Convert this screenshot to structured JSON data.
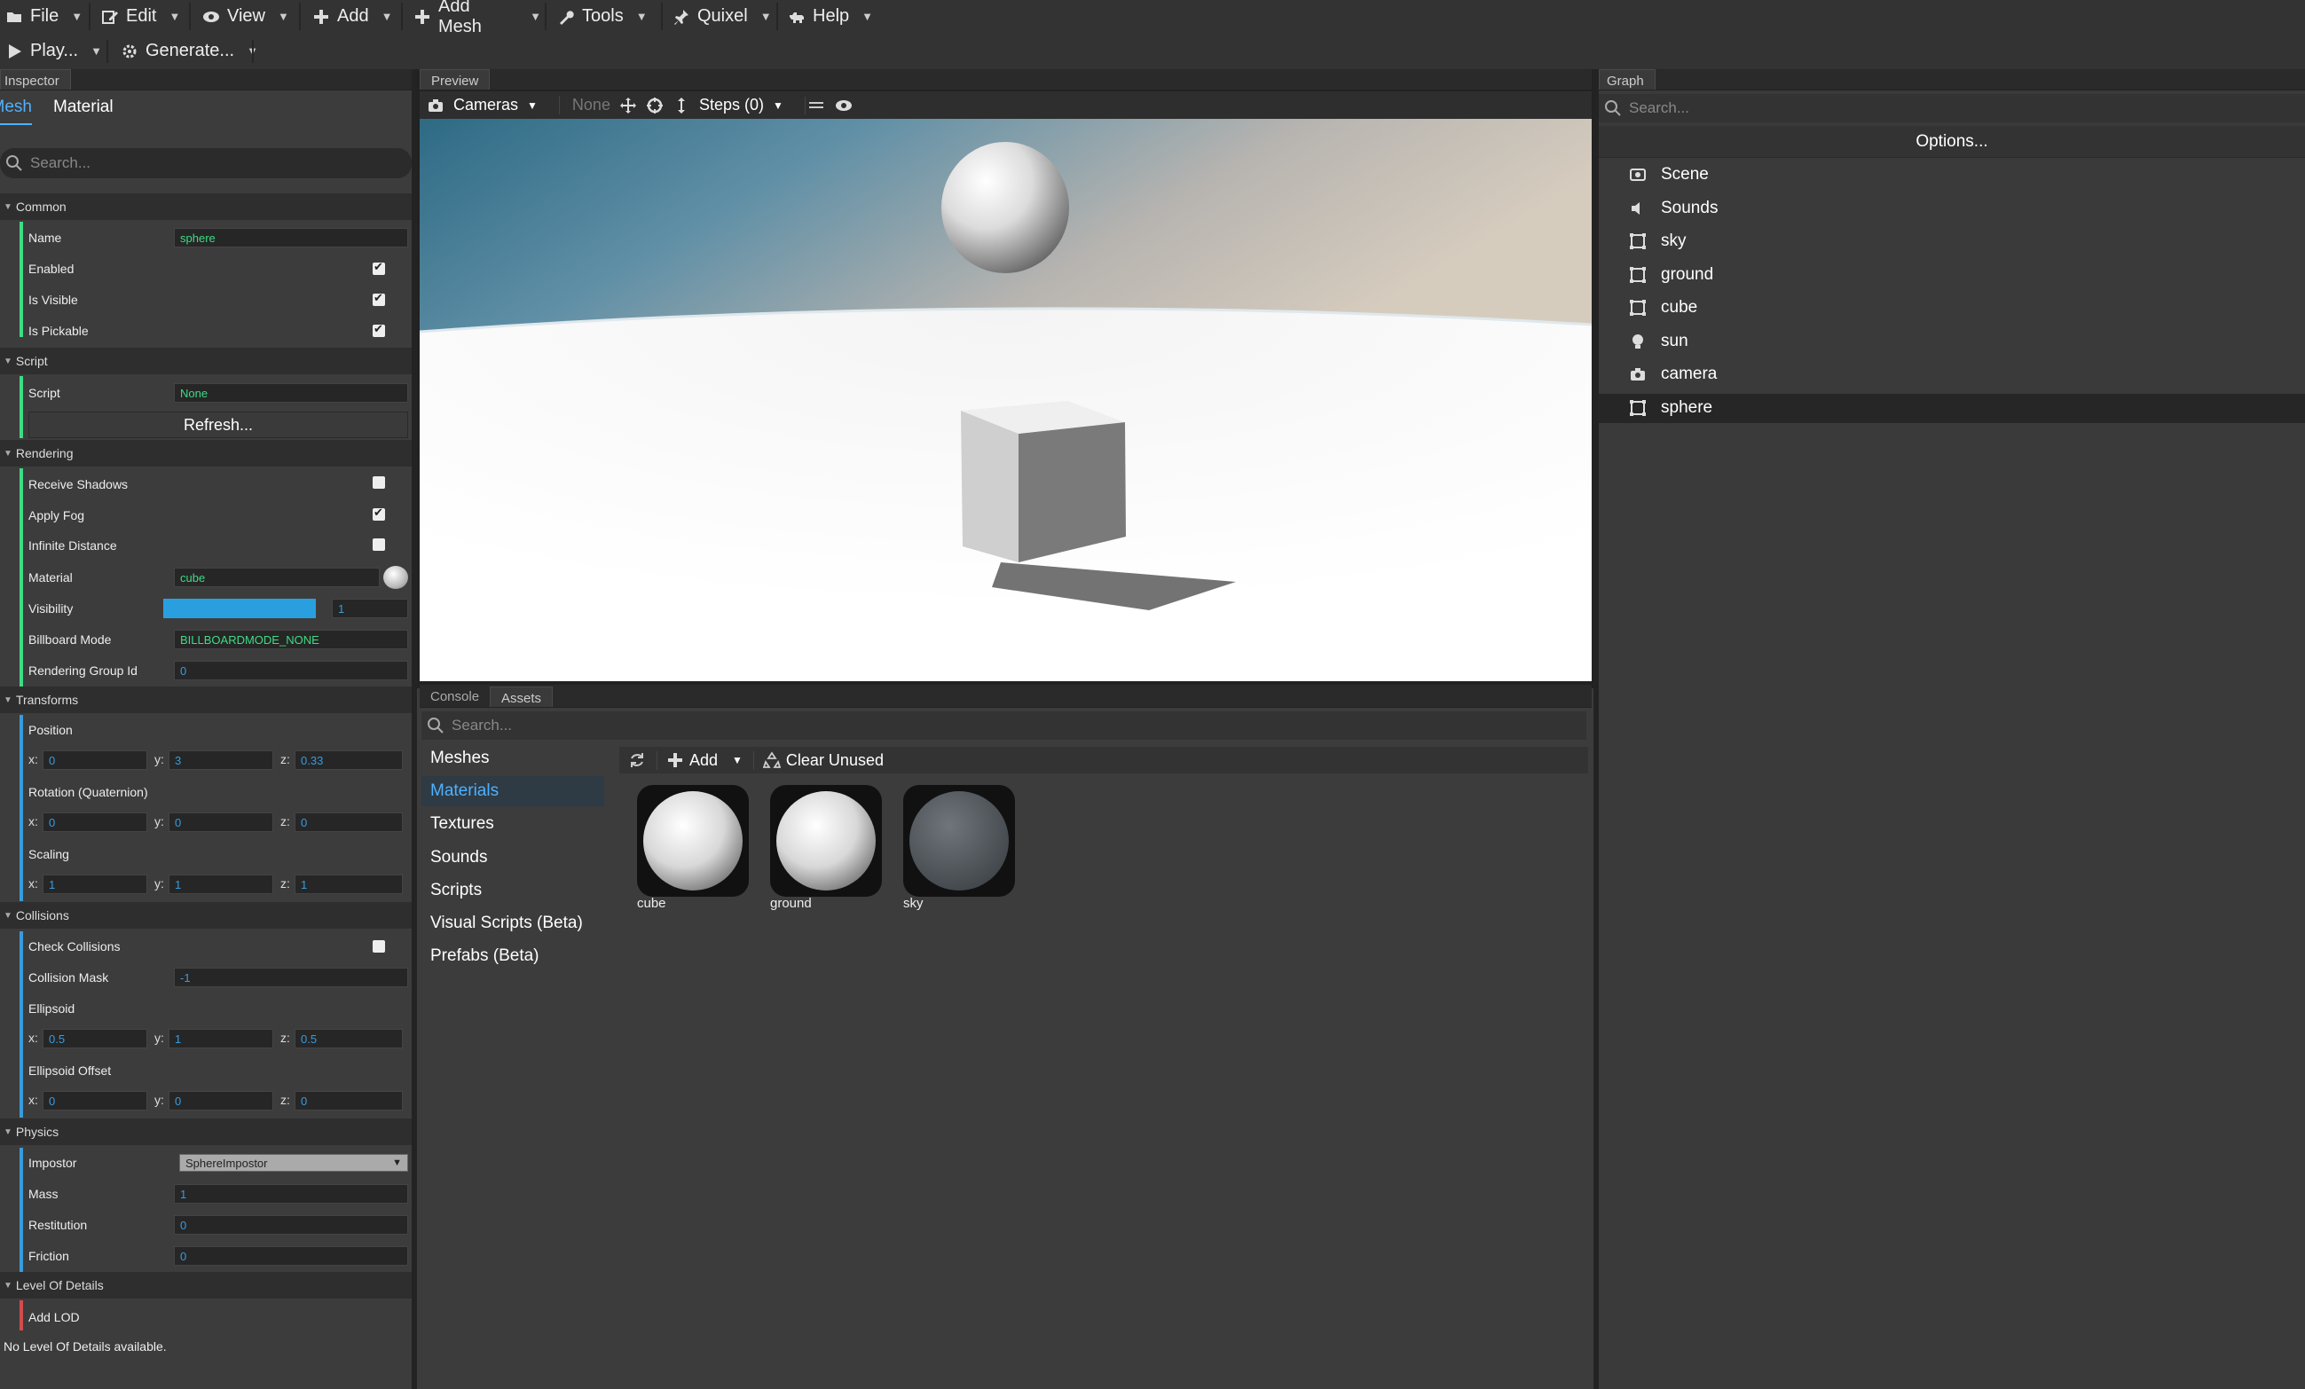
{
  "menubar": {
    "items": [
      {
        "label": "File",
        "icon": "folder-icon"
      },
      {
        "label": "Edit",
        "icon": "edit-icon"
      },
      {
        "label": "View",
        "icon": "eye-icon"
      },
      {
        "label": "Add",
        "icon": "plus-icon"
      },
      {
        "label": "Add Mesh",
        "icon": "plus-icon"
      },
      {
        "label": "Tools",
        "icon": "wrench-icon"
      },
      {
        "label": "Quixel",
        "icon": "pin-icon"
      },
      {
        "label": "Help",
        "icon": "dog-icon"
      }
    ]
  },
  "toolbar2": {
    "play_label": "Play...",
    "generate_label": "Generate..."
  },
  "inspector": {
    "title": "Inspector",
    "tab_mesh": "Mesh",
    "tab_material": "Material",
    "search_placeholder": "Search...",
    "common": {
      "title": "Common",
      "name_label": "Name",
      "name_value": "sphere",
      "enabled_label": "Enabled",
      "visible_label": "Is Visible",
      "pickable_label": "Is Pickable"
    },
    "script": {
      "title": "Script",
      "script_label": "Script",
      "script_value": "None",
      "refresh_label": "Refresh..."
    },
    "rendering": {
      "title": "Rendering",
      "receive_shadows": "Receive Shadows",
      "apply_fog": "Apply Fog",
      "infinite_distance": "Infinite Distance",
      "material_label": "Material",
      "material_value": "cube",
      "visibility_label": "Visibility",
      "visibility_value": "1",
      "billboard_label": "Billboard Mode",
      "billboard_value": "BILLBOARDMODE_NONE",
      "rgroup_label": "Rendering Group Id",
      "rgroup_value": "0"
    },
    "transforms": {
      "title": "Transforms",
      "position_label": "Position",
      "position": {
        "x": "0",
        "y": "3",
        "z": "0.33"
      },
      "rotation_label": "Rotation (Quaternion)",
      "rotation": {
        "x": "0",
        "y": "0",
        "z": "0"
      },
      "scaling_label": "Scaling",
      "scaling": {
        "x": "1",
        "y": "1",
        "z": "1"
      }
    },
    "collisions": {
      "title": "Collisions",
      "check_label": "Check Collisions",
      "mask_label": "Collision Mask",
      "mask_value": "-1",
      "ellipsoid_label": "Ellipsoid",
      "ellipsoid": {
        "x": "0.5",
        "y": "1",
        "z": "0.5"
      },
      "offset_label": "Ellipsoid Offset",
      "offset": {
        "x": "0",
        "y": "0",
        "z": "0"
      }
    },
    "physics": {
      "title": "Physics",
      "impostor_label": "Impostor",
      "impostor_value": "SphereImpostor",
      "mass_label": "Mass",
      "mass_value": "1",
      "restitution_label": "Restitution",
      "restitution_value": "0",
      "friction_label": "Friction",
      "friction_value": "0"
    },
    "lod": {
      "title": "Level Of Details",
      "add_label": "Add LOD",
      "none_text": "No Level Of Details available."
    },
    "axis": {
      "x": "x:",
      "y": "y:",
      "z": "z:"
    }
  },
  "preview": {
    "title": "Preview",
    "cameras_label": "Cameras",
    "none_label": "None",
    "steps_label": "Steps (0)"
  },
  "graph": {
    "title": "Graph",
    "search_placeholder": "Search...",
    "options_label": "Options...",
    "items": [
      {
        "label": "Scene",
        "icon": "scene-icon"
      },
      {
        "label": "Sounds",
        "icon": "speaker-icon"
      },
      {
        "label": "sky",
        "icon": "mesh-icon"
      },
      {
        "label": "ground",
        "icon": "mesh-icon"
      },
      {
        "label": "cube",
        "icon": "mesh-icon"
      },
      {
        "label": "sun",
        "icon": "bulb-icon"
      },
      {
        "label": "camera",
        "icon": "camera-icon"
      },
      {
        "label": "sphere",
        "icon": "mesh-icon"
      }
    ],
    "selected": "sphere"
  },
  "assets": {
    "tab_console": "Console",
    "tab_assets": "Assets",
    "search_placeholder": "Search...",
    "add_label": "Add",
    "clear_label": "Clear Unused",
    "categories": [
      "Meshes",
      "Materials",
      "Textures",
      "Sounds",
      "Scripts",
      "Visual Scripts (Beta)",
      "Prefabs (Beta)"
    ],
    "selected_category": "Materials",
    "thumbnails": [
      "cube",
      "ground",
      "sky"
    ]
  },
  "colors": {
    "accent": "#3a9bdc",
    "green_text": "#3ddc84",
    "selected_bg": "#2a2a2a"
  }
}
